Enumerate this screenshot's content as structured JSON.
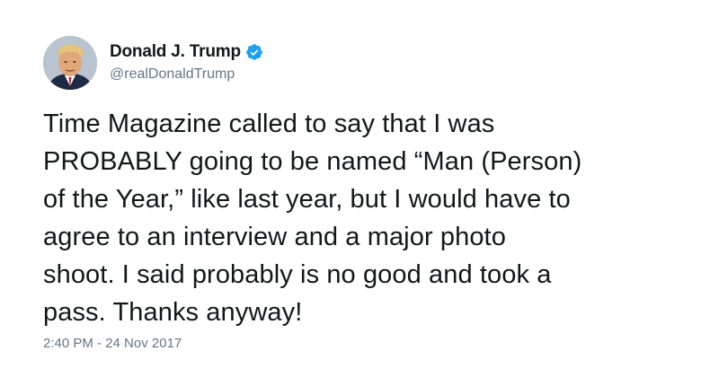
{
  "tweet": {
    "author": {
      "display_name": "Donald J. Trump",
      "handle": "@realDonaldTrump",
      "verified": true,
      "verified_color": "#1da1f2",
      "avatar_icon": "profile-photo"
    },
    "text": "Time Magazine called to say that I was\nPROBABLY going to be named “Man (Person)\nof the Year,” like last year, but I would have to\nagree to an interview and a major photo\nshoot. I said probably is no good and took a\npass. Thanks anyway!",
    "timestamp": "2:40 PM - 24 Nov 2017"
  }
}
